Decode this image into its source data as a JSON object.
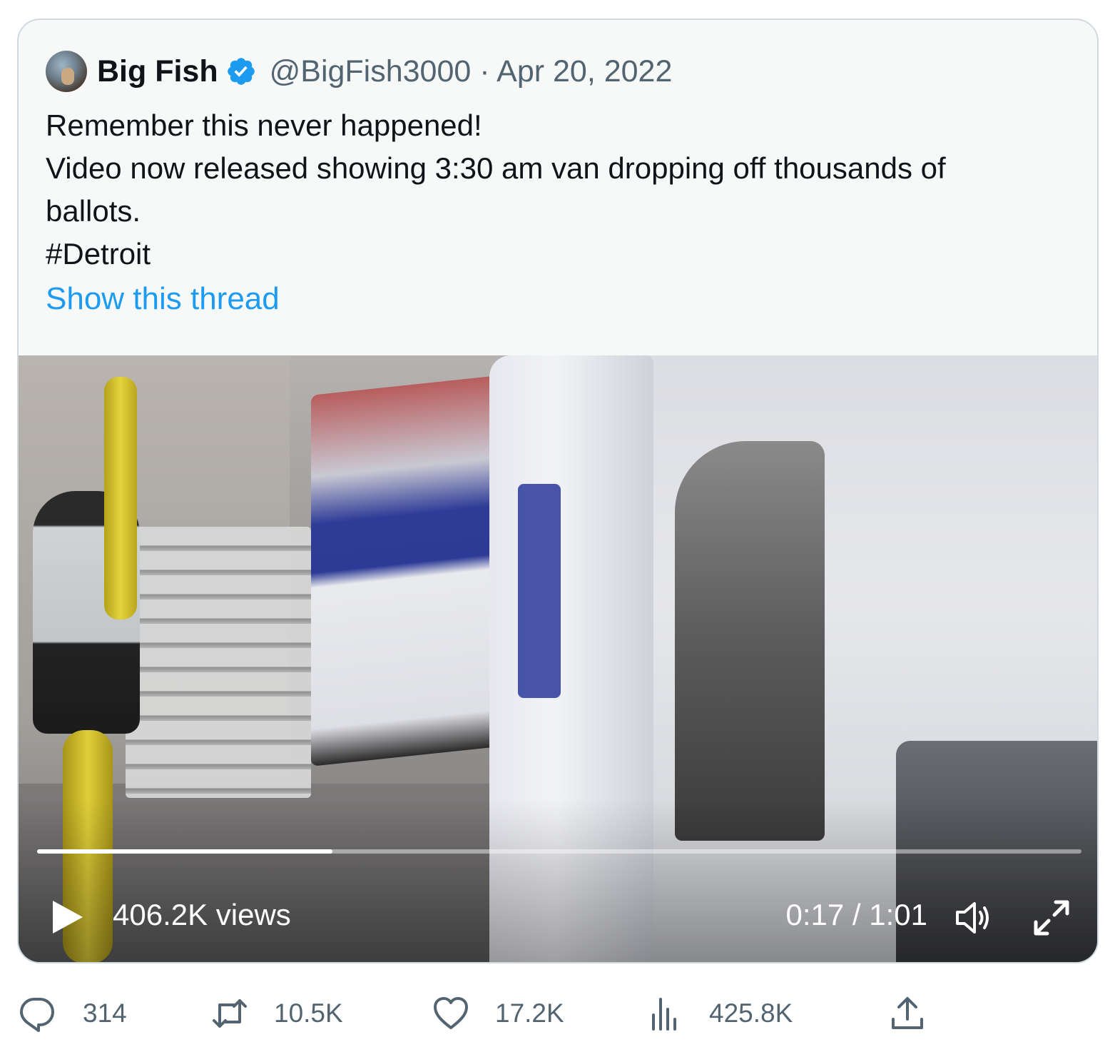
{
  "tweet": {
    "author_name": "Big Fish",
    "handle_date": "@BigFish3000 · Apr 20, 2022",
    "lines": [
      "Remember this never happened!",
      "Video now released showing 3:30 am van dropping off thousands of",
      "ballots.",
      "#Detroit"
    ],
    "show_thread": "Show this thread"
  },
  "video": {
    "views": "406.2K views",
    "time": "0:17 / 1:01",
    "progress": 0.283
  },
  "actions": {
    "replies": "314",
    "retweets": "10.5K",
    "likes": "17.2K",
    "views": "425.8K"
  },
  "icons": {
    "verified": "verified-badge-icon",
    "play": "play-icon",
    "volume": "volume-icon",
    "fullscreen": "fullscreen-icon",
    "reply": "reply-icon",
    "retweet": "retweet-icon",
    "like": "heart-icon",
    "analytics": "analytics-icon",
    "share": "share-icon"
  },
  "colors": {
    "link": "#1d9bf0",
    "verified": "#1d9bf0",
    "secondary_text": "#536471",
    "card_background": "#f7f9f9"
  }
}
